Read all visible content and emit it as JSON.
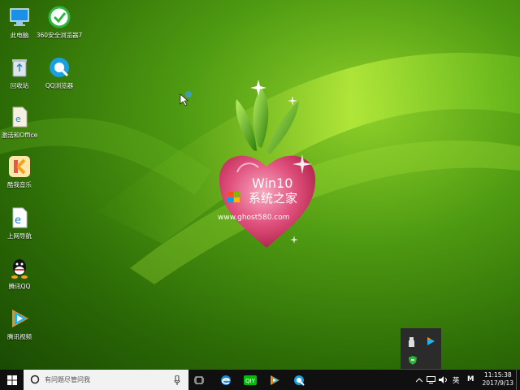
{
  "desktop": {
    "icons": [
      {
        "label": "此电脑",
        "icon": "this-pc-icon"
      },
      {
        "label": "360安全浏览器7",
        "icon": "360-browser-icon"
      },
      {
        "label": "回收站",
        "icon": "recycle-bin-icon"
      },
      {
        "label": "QQ浏览器",
        "icon": "qq-browser-icon"
      },
      {
        "label": "激活和Office",
        "icon": "activation-office-icon"
      },
      {
        "label": "酷我音乐",
        "icon": "kuwo-music-icon"
      },
      {
        "label": "上网导航",
        "icon": "web-navigation-icon"
      },
      {
        "label": "腾讯QQ",
        "icon": "tencent-qq-icon"
      },
      {
        "label": "腾讯视频",
        "icon": "tencent-video-icon"
      }
    ]
  },
  "wallpaper": {
    "logo_line1": "Win10",
    "logo_line2": "系统之家",
    "logo_url": "www.ghost580.com"
  },
  "taskbar": {
    "search_placeholder": "有问题尽管问我",
    "ime_label": "英",
    "ime_mode": "M",
    "time": "11:15:38",
    "date": "2017/9/13"
  },
  "colors": {
    "taskbar": "#101010",
    "search_bg": "#f2f2f2",
    "wallpaper_green": "#4f9b12",
    "heart_pink": "#d8436f"
  }
}
